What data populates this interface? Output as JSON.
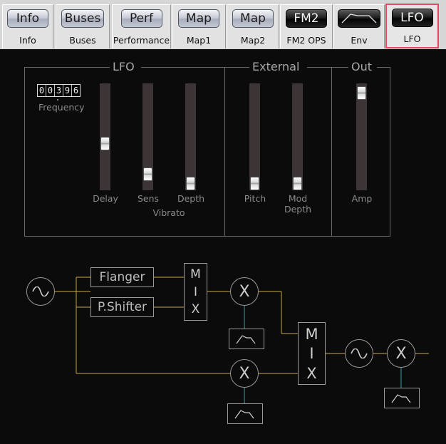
{
  "tabs": [
    {
      "button": "Info",
      "label": "Info",
      "dark": false,
      "active": false
    },
    {
      "button": "Buses",
      "label": "Buses",
      "dark": false,
      "active": false
    },
    {
      "button": "Perf",
      "label": "Performance",
      "dark": false,
      "active": false
    },
    {
      "button": "Map",
      "label": "Map1",
      "dark": false,
      "active": false
    },
    {
      "button": "Map",
      "label": "Map2",
      "dark": false,
      "active": false
    },
    {
      "button": "FM2",
      "label": "FM2 OPS",
      "dark": true,
      "active": false
    },
    {
      "button": "",
      "label": "Env",
      "dark": true,
      "active": false,
      "icon": "envelope-icon"
    },
    {
      "button": "LFO",
      "label": "LFO",
      "dark": true,
      "active": true
    }
  ],
  "sections": {
    "lfo": "LFO",
    "external": "External",
    "out": "Out"
  },
  "frequency": {
    "digits": [
      "0",
      "0",
      "3",
      "9",
      "6"
    ],
    "label": "Frequency"
  },
  "sliders": [
    {
      "id": "delay",
      "label": "Delay",
      "value": 0.44
    },
    {
      "id": "sens",
      "label": "Sens",
      "value": 0.1
    },
    {
      "id": "depth",
      "label": "Depth",
      "value": 0.0
    },
    {
      "id": "pitch",
      "label": "Pitch",
      "value": 0.0
    },
    {
      "id": "mod-depth",
      "label": "Mod\nDepth",
      "value": 0.0
    },
    {
      "id": "amp",
      "label": "Amp",
      "value": 1.0
    }
  ],
  "vibrato_label": "Vibrato",
  "diagram": {
    "flanger": "Flanger",
    "pshifter": "P.Shifter",
    "mix1": [
      "M",
      "I",
      "X"
    ],
    "mix2": [
      "M",
      "I",
      "X"
    ],
    "multiply": "X",
    "colors": {
      "wire": "#c8a94a",
      "mod": "#3fa2a0",
      "border": "#9a9a9a"
    }
  }
}
